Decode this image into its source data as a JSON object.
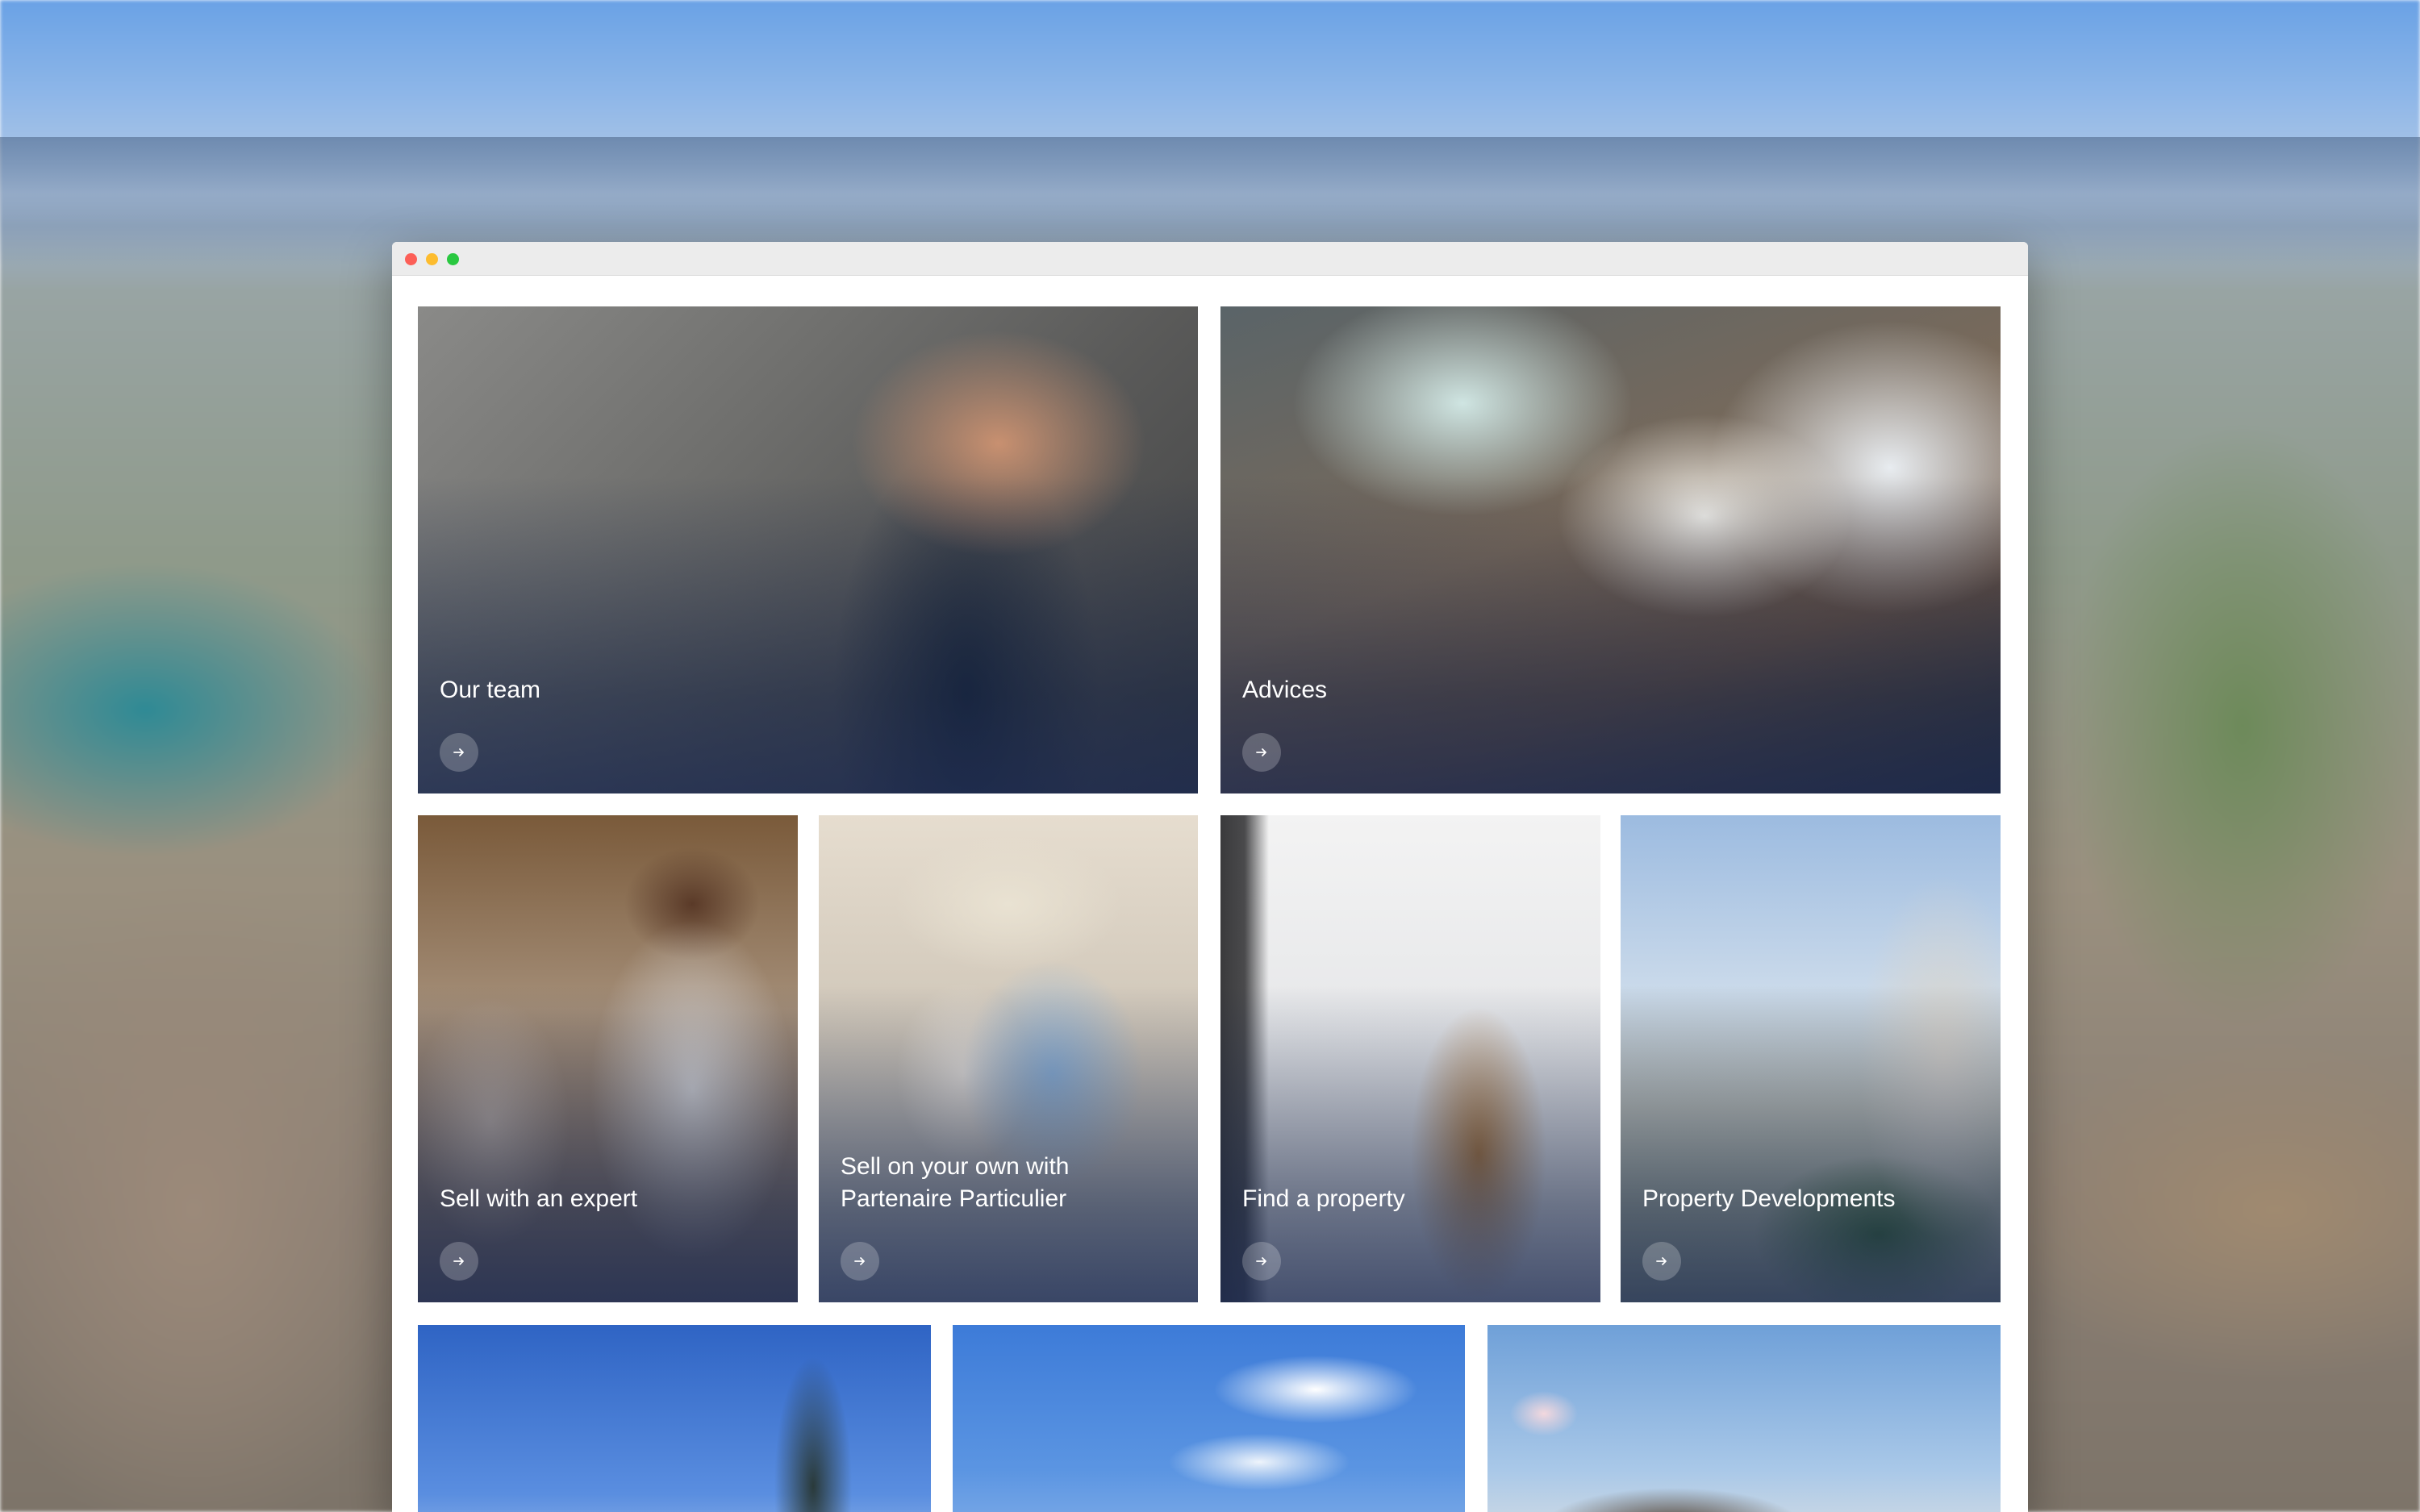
{
  "window": {
    "controls": [
      "close",
      "minimize",
      "maximize"
    ]
  },
  "cards": {
    "our_team": {
      "label": "Our team",
      "icon": "arrow-right-icon"
    },
    "advices": {
      "label": "Advices",
      "icon": "arrow-right-icon"
    },
    "sell_expert": {
      "label": "Sell with an expert",
      "icon": "arrow-right-icon"
    },
    "sell_own": {
      "label": "Sell on your own with Partenaire Particulier",
      "icon": "arrow-right-icon"
    },
    "find_property": {
      "label": "Find a property",
      "icon": "arrow-right-icon"
    },
    "property_developments": {
      "label": "Property Developments",
      "icon": "arrow-right-icon"
    }
  },
  "colors": {
    "close": "#fc5f57",
    "minimize": "#fdbc2e",
    "maximize": "#29c840",
    "overlay": "#192850"
  }
}
